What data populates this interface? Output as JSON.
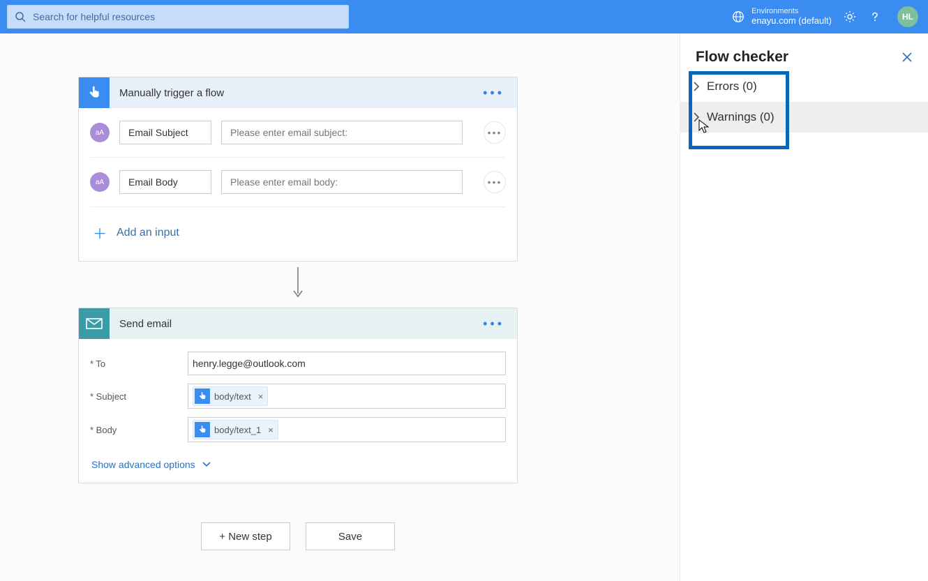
{
  "topbar": {
    "search_placeholder": "Search for helpful resources",
    "env_label": "Environments",
    "env_name": "enayu.com (default)",
    "avatar_initials": "HL"
  },
  "trigger": {
    "title": "Manually trigger a flow",
    "inputs": [
      {
        "type_badge": "aA",
        "label": "Email Subject",
        "placeholder": "Please enter email subject:"
      },
      {
        "type_badge": "aA",
        "label": "Email Body",
        "placeholder": "Please enter email body:"
      }
    ],
    "add_input_label": "Add an input"
  },
  "action": {
    "title": "Send email",
    "fields": {
      "to": {
        "label": "* To",
        "value": "henry.legge@outlook.com"
      },
      "subject": {
        "label": "* Subject",
        "token": "body/text"
      },
      "body": {
        "label": "* Body",
        "token": "body/text_1"
      }
    },
    "advanced_label": "Show advanced options"
  },
  "buttons": {
    "new_step": "+ New step",
    "save": "Save"
  },
  "panel": {
    "title": "Flow checker",
    "errors_label": "Errors (0)",
    "warnings_label": "Warnings (0)"
  }
}
